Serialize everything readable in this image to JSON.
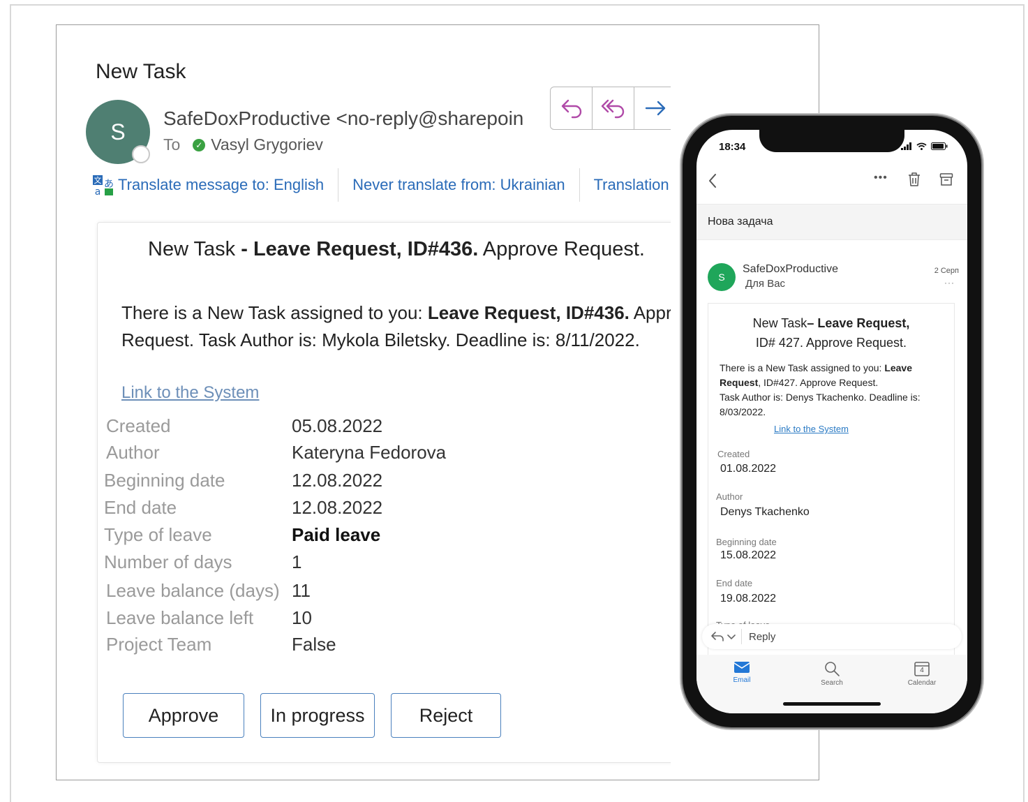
{
  "desktop": {
    "subject": "New Task",
    "avatar_initial": "S",
    "sender": "SafeDoxProductive <no-reply@sharepoin",
    "to_label": "To",
    "recipient": "Vasyl Grygoriev",
    "translate": {
      "translate_to": "Translate message to: English",
      "never_translate": "Never translate from: Ukrainian",
      "translation_prefs": "Translation"
    },
    "card": {
      "title_plain": "New Task ",
      "title_bold": "- Leave Request, ID#436.",
      "title_tail": " Approve Request.",
      "body_line1_plain": "There is a New Task assigned to you: ",
      "body_line1_bold": "Leave Request, ID#436.",
      "body_line1_tail": " Appr",
      "body_line2": "Request. Task Author is: Mykola Biletsky. Deadline is: 8/11/2022.",
      "link": "Link to the System",
      "fields": [
        {
          "label": "Created",
          "value": "05.08.2022"
        },
        {
          "label": "Author",
          "value": "Kateryna Fedorova"
        },
        {
          "label": "Beginning date",
          "value": "12.08.2022"
        },
        {
          "label": "End date",
          "value": "12.08.2022"
        },
        {
          "label": "Type of leave",
          "value": "Paid leave"
        },
        {
          "label": "Number of days",
          "value": "1"
        },
        {
          "label": "Leave balance (days)",
          "value": "11"
        },
        {
          "label": "Leave balance left",
          "value": "10"
        },
        {
          "label": "Project Team",
          "value": "False"
        }
      ],
      "buttons": {
        "approve": "Approve",
        "in_progress": "In progress",
        "reject": "Reject"
      }
    }
  },
  "phone": {
    "time": "18:34",
    "subject": "Нова задача",
    "avatar_initial": "S",
    "sender": "SafeDoxProductive",
    "recipient": "Для Вас",
    "date": "2 Серп",
    "more": "···",
    "card": {
      "title_line1_plain": "New  Task",
      "title_line1_bold": "– Leave Request,",
      "title_line2": "ID# 427. Approve Request.",
      "body_intro": "There is a New Task assigned to you: ",
      "body_bold1": "Leave",
      "body_bold2": "Request",
      "body_rest": ", ID#427. Approve Request.",
      "body_line3": "Task Author is: Denys Tkachenko. Deadline is:",
      "body_line4": "8/03/2022.",
      "link": "Link to the System",
      "fields": [
        {
          "label": "Created",
          "value": "01.08.2022"
        },
        {
          "label": "Author",
          "value": "Denys Tkachenko"
        },
        {
          "label": "Beginning date",
          "value": "15.08.2022"
        },
        {
          "label": "End date",
          "value": "19.08.2022"
        },
        {
          "label": "Type of leave",
          "value": ""
        }
      ]
    },
    "reply_label": "Reply",
    "tabs": {
      "email": "Email",
      "search": "Search",
      "calendar": "Calendar",
      "calendar_day": "4"
    },
    "accent_color": "#2378d6"
  }
}
